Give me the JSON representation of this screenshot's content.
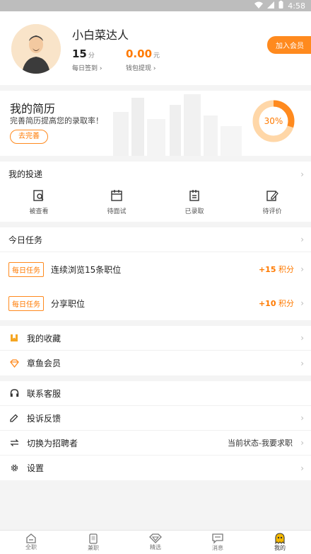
{
  "status_bar": {
    "time": "4:58"
  },
  "profile": {
    "name": "小白菜达人",
    "points_value": "15",
    "points_unit": "分",
    "points_label": "每日签到",
    "wallet_value": "0.00",
    "wallet_unit": "元",
    "wallet_label": "钱包提现",
    "join_label": "加入会员"
  },
  "resume": {
    "title": "我的简历",
    "subtitle": "完善简历提高您的录取率！",
    "button": "去完善",
    "progress": 0.3,
    "progress_label": "30%"
  },
  "delivery": {
    "title": "我的投递",
    "items": [
      {
        "label": "被查看",
        "icon": "viewed-icon"
      },
      {
        "label": "待面试",
        "icon": "calendar-icon"
      },
      {
        "label": "已录取",
        "icon": "hired-icon"
      },
      {
        "label": "待评价",
        "icon": "review-icon"
      }
    ]
  },
  "tasks": {
    "title": "今日任务",
    "items": [
      {
        "tag": "每日任务",
        "name": "连续浏览15条职位",
        "points": "+15",
        "points_unit": "积分"
      },
      {
        "tag": "每日任务",
        "name": "分享职位",
        "points": "+10",
        "points_unit": "积分"
      }
    ]
  },
  "menu1": [
    {
      "label": "我的收藏",
      "icon": "favorite-icon"
    },
    {
      "label": "章鱼会员",
      "icon": "diamond-icon"
    }
  ],
  "menu2": [
    {
      "label": "联系客服",
      "icon": "headset-icon"
    },
    {
      "label": "投诉反馈",
      "icon": "edit-icon"
    },
    {
      "label": "切换为招聘者",
      "icon": "switch-icon",
      "right": "当前状态-我要求职"
    },
    {
      "label": "设置",
      "icon": "gear-icon"
    }
  ],
  "tabs": [
    {
      "label": "全职",
      "icon": "home-icon"
    },
    {
      "label": "兼职",
      "icon": "phone-icon"
    },
    {
      "label": "精选",
      "icon": "gem-icon"
    },
    {
      "label": "消息",
      "icon": "message-icon"
    },
    {
      "label": "我的",
      "icon": "octopus-icon"
    }
  ],
  "colors": {
    "accent": "#ff8a1e",
    "accent_text": "#ff7a00"
  }
}
